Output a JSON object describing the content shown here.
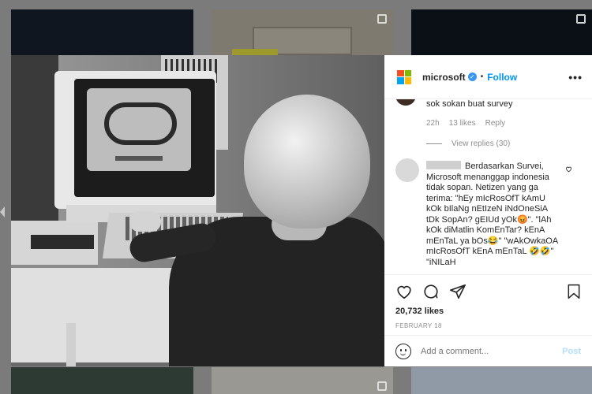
{
  "post": {
    "username": "microsoft",
    "verified_mark": "✓",
    "separator": "•",
    "follow_label": "Follow",
    "more_label": "•••",
    "logo_colors": [
      "#f25022",
      "#7fba00",
      "#00a4ef",
      "#ffb900"
    ]
  },
  "comments": {
    "first": {
      "text": "sok sokan buat survey",
      "time": "22h",
      "likes": "13 likes",
      "reply": "Reply",
      "view_replies": "View replies (30)"
    },
    "second": {
      "body": " Berdasarkan Survei, Microsoft menanggap indonesia tidak sopan. Netizen yang ga terima: \"hEy mIcRosOfT kAmU kOk bIlaNg nEtIzeN iNdOneSiA tDk SopAn? gEIUd yOk😡\". \"lAh kOk diMatlin KomEnTar? kEnA mEnTaL ya bOs😂\" \"wAkOwkaOA mIcRosOfT kEnA mEnTaL 🤣🤣\" \"iNILaH"
    }
  },
  "actions": {
    "likes": "20,732 likes",
    "date": "FEBRUARY 18"
  },
  "composer": {
    "placeholder": "Add a comment...",
    "post_label": "Post"
  },
  "icons": {
    "like": "heart-icon",
    "comment": "comment-icon",
    "share": "share-icon",
    "save": "bookmark-icon",
    "emoji": "emoji-icon",
    "multi": "carousel-icon"
  }
}
